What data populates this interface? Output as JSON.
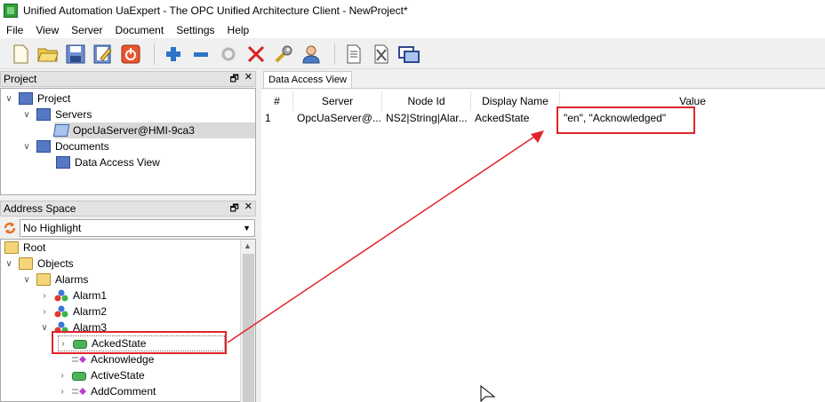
{
  "window": {
    "title": "Unified Automation UaExpert - The OPC Unified Architecture Client - NewProject*"
  },
  "menu": [
    {
      "label": "File"
    },
    {
      "label": "View"
    },
    {
      "label": "Server"
    },
    {
      "label": "Document"
    },
    {
      "label": "Settings"
    },
    {
      "label": "Help"
    }
  ],
  "toolbar": {
    "buttons": [
      "new-project-icon",
      "open-folder-icon",
      "save-icon",
      "edit-icon",
      "power-icon",
      "add-icon",
      "remove-icon",
      "connect-icon",
      "disconnect-icon",
      "wrench-icon",
      "user-icon",
      "document-icon",
      "delete-document-icon",
      "window-icon"
    ]
  },
  "project_panel": {
    "title": "Project",
    "tree": [
      {
        "label": "Project"
      },
      {
        "label": "Servers"
      },
      {
        "label": "OpcUaServer@HMI-9ca3"
      },
      {
        "label": "Documents"
      },
      {
        "label": "Data Access View"
      }
    ]
  },
  "address_panel": {
    "title": "Address Space",
    "filter_value": "No Highlight",
    "tree": [
      {
        "label": "Root"
      },
      {
        "label": "Objects"
      },
      {
        "label": "Alarms"
      },
      {
        "label": "Alarm1"
      },
      {
        "label": "Alarm2"
      },
      {
        "label": "Alarm3"
      },
      {
        "label": "AckedState"
      },
      {
        "label": "Acknowledge"
      },
      {
        "label": "ActiveState"
      },
      {
        "label": "AddComment"
      }
    ]
  },
  "data_view": {
    "tab_label": "Data Access View",
    "columns": [
      "#",
      "Server",
      "Node Id",
      "Display Name",
      "Value"
    ],
    "rows": [
      {
        "index": "1",
        "server": "OpcUaServer@...",
        "node_id": "NS2|String|Alar...",
        "display_name": "AckedState",
        "value": "\"en\", \"Acknowledged\""
      }
    ]
  },
  "colors": {
    "highlight": "#e0242b"
  }
}
